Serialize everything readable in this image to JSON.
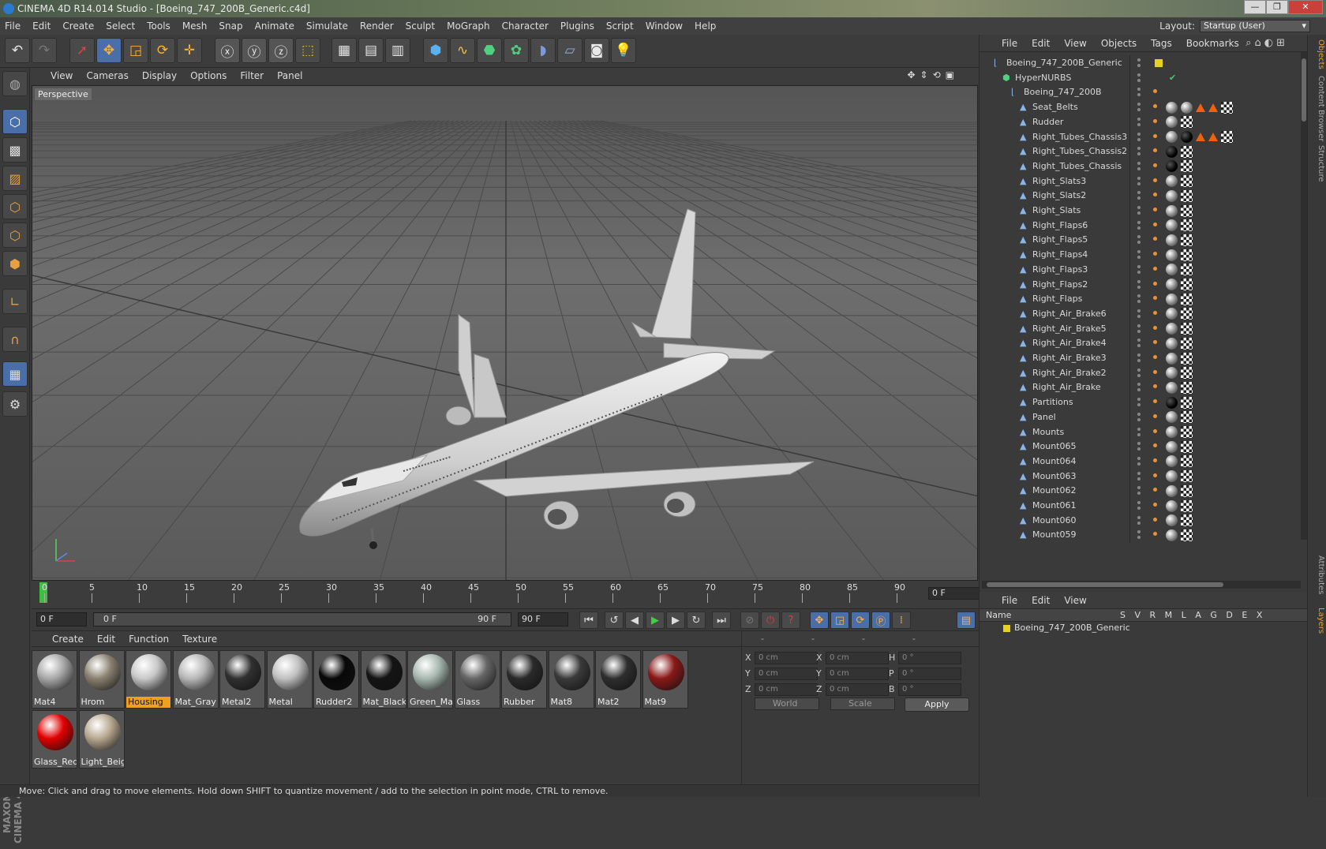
{
  "window": {
    "title": "CINEMA 4D R14.014 Studio - [Boeing_747_200B_Generic.c4d]",
    "controls": [
      "—",
      "❐",
      "✕"
    ]
  },
  "menu": [
    "File",
    "Edit",
    "Create",
    "Select",
    "Tools",
    "Mesh",
    "Snap",
    "Animate",
    "Simulate",
    "Render",
    "Sculpt",
    "MoGraph",
    "Character",
    "Plugins",
    "Script",
    "Window",
    "Help"
  ],
  "layout": {
    "label": "Layout:",
    "value": "Startup (User)"
  },
  "viewport": {
    "menu": [
      "View",
      "Cameras",
      "Display",
      "Options",
      "Filter",
      "Panel"
    ],
    "label": "Perspective"
  },
  "timeline": {
    "ticks": [
      "0",
      "5",
      "10",
      "15",
      "20",
      "25",
      "30",
      "35",
      "40",
      "45",
      "50",
      "55",
      "60",
      "65",
      "70",
      "75",
      "80",
      "85",
      "90"
    ],
    "current_frame": "0 F",
    "start_field": "0 F",
    "range_start": "0 F",
    "range_end": "90 F",
    "end_field": "90 F"
  },
  "materials": {
    "menu": [
      "Create",
      "Edit",
      "Function",
      "Texture"
    ],
    "items": [
      {
        "name": "Mat4",
        "color": "#a8a8a8",
        "selected": false
      },
      {
        "name": "Hrom",
        "color": "#8a8070",
        "selected": false
      },
      {
        "name": "Housing",
        "color": "#c8c8c8",
        "selected": true
      },
      {
        "name": "Mat_Gray",
        "color": "#b8b8b8",
        "selected": false
      },
      {
        "name": "Metal2",
        "color": "#303030",
        "selected": false
      },
      {
        "name": "Metal",
        "color": "#c0c0c0",
        "selected": false
      },
      {
        "name": "Rudder2",
        "color": "#080808",
        "selected": false
      },
      {
        "name": "Mat_Black",
        "color": "#141414",
        "selected": false
      },
      {
        "name": "Green_Mat",
        "color": "#a8b8b0",
        "selected": false
      },
      {
        "name": "Glass",
        "color": "#666666",
        "selected": false
      },
      {
        "name": "Rubber",
        "color": "#2a2a2a",
        "selected": false
      },
      {
        "name": "Mat8",
        "color": "#3a3a3a",
        "selected": false
      },
      {
        "name": "Mat2",
        "color": "#2e2e2e",
        "selected": false
      },
      {
        "name": "Mat9",
        "color": "#8a1818",
        "selected": false
      },
      {
        "name": "Glass_Red",
        "color": "#e00000",
        "selected": false
      },
      {
        "name": "Light_Beig",
        "color": "#b8a890",
        "selected": false
      }
    ]
  },
  "coords": {
    "header": [
      "--",
      "--",
      "--"
    ],
    "rows": [
      {
        "a": "X",
        "av": "0 cm",
        "b": "X",
        "bv": "0 cm",
        "c": "H",
        "cv": "0 °"
      },
      {
        "a": "Y",
        "av": "0 cm",
        "b": "Y",
        "bv": "0 cm",
        "c": "P",
        "cv": "0 °"
      },
      {
        "a": "Z",
        "av": "0 cm",
        "b": "Z",
        "bv": "0 cm",
        "c": "B",
        "cv": "0 °"
      }
    ],
    "world": "World",
    "scale": "Scale",
    "apply": "Apply"
  },
  "status": "Move: Click and drag to move elements. Hold down SHIFT to quantize movement / add to the selection in point mode, CTRL to remove.",
  "objects": {
    "menu": [
      "File",
      "Edit",
      "View",
      "Objects",
      "Tags",
      "Bookmarks"
    ],
    "tree": [
      {
        "name": "Boeing_747_200B_Generic",
        "depth": 0,
        "icon": "null",
        "tags": []
      },
      {
        "name": "HyperNURBS",
        "depth": 1,
        "icon": "nurbs",
        "tags": []
      },
      {
        "name": "Boeing_747_200B",
        "depth": 2,
        "icon": "null",
        "tags": []
      },
      {
        "name": "Seat_Belts",
        "depth": 3,
        "icon": "poly",
        "tags": [
          "s",
          "s",
          "t",
          "t",
          "c"
        ]
      },
      {
        "name": "Rudder",
        "depth": 3,
        "icon": "poly",
        "tags": [
          "s",
          "c"
        ]
      },
      {
        "name": "Right_Tubes_Chassis3",
        "depth": 3,
        "icon": "poly",
        "tags": [
          "s",
          "b",
          "t",
          "t",
          "c"
        ]
      },
      {
        "name": "Right_Tubes_Chassis2",
        "depth": 3,
        "icon": "poly",
        "tags": [
          "b",
          "c"
        ]
      },
      {
        "name": "Right_Tubes_Chassis",
        "depth": 3,
        "icon": "poly",
        "tags": [
          "b",
          "c"
        ]
      },
      {
        "name": "Right_Slats3",
        "depth": 3,
        "icon": "poly",
        "tags": [
          "s",
          "c"
        ]
      },
      {
        "name": "Right_Slats2",
        "depth": 3,
        "icon": "poly",
        "tags": [
          "s",
          "c"
        ]
      },
      {
        "name": "Right_Slats",
        "depth": 3,
        "icon": "poly",
        "tags": [
          "s",
          "c"
        ]
      },
      {
        "name": "Right_Flaps6",
        "depth": 3,
        "icon": "poly",
        "tags": [
          "s",
          "c"
        ]
      },
      {
        "name": "Right_Flaps5",
        "depth": 3,
        "icon": "poly",
        "tags": [
          "s",
          "c"
        ]
      },
      {
        "name": "Right_Flaps4",
        "depth": 3,
        "icon": "poly",
        "tags": [
          "s",
          "c"
        ]
      },
      {
        "name": "Right_Flaps3",
        "depth": 3,
        "icon": "poly",
        "tags": [
          "s",
          "c"
        ]
      },
      {
        "name": "Right_Flaps2",
        "depth": 3,
        "icon": "poly",
        "tags": [
          "s",
          "c"
        ]
      },
      {
        "name": "Right_Flaps",
        "depth": 3,
        "icon": "poly",
        "tags": [
          "s",
          "c"
        ]
      },
      {
        "name": "Right_Air_Brake6",
        "depth": 3,
        "icon": "poly",
        "tags": [
          "s",
          "c"
        ]
      },
      {
        "name": "Right_Air_Brake5",
        "depth": 3,
        "icon": "poly",
        "tags": [
          "s",
          "c"
        ]
      },
      {
        "name": "Right_Air_Brake4",
        "depth": 3,
        "icon": "poly",
        "tags": [
          "s",
          "c"
        ]
      },
      {
        "name": "Right_Air_Brake3",
        "depth": 3,
        "icon": "poly",
        "tags": [
          "s",
          "c"
        ]
      },
      {
        "name": "Right_Air_Brake2",
        "depth": 3,
        "icon": "poly",
        "tags": [
          "s",
          "c"
        ]
      },
      {
        "name": "Right_Air_Brake",
        "depth": 3,
        "icon": "poly",
        "tags": [
          "s",
          "c"
        ]
      },
      {
        "name": "Partitions",
        "depth": 3,
        "icon": "poly",
        "tags": [
          "b",
          "c"
        ]
      },
      {
        "name": "Panel",
        "depth": 3,
        "icon": "poly",
        "tags": [
          "s",
          "c"
        ]
      },
      {
        "name": "Mounts",
        "depth": 3,
        "icon": "poly",
        "tags": [
          "s",
          "c"
        ]
      },
      {
        "name": "Mount065",
        "depth": 3,
        "icon": "poly",
        "tags": [
          "s",
          "c"
        ]
      },
      {
        "name": "Mount064",
        "depth": 3,
        "icon": "poly",
        "tags": [
          "s",
          "c"
        ]
      },
      {
        "name": "Mount063",
        "depth": 3,
        "icon": "poly",
        "tags": [
          "s",
          "c"
        ]
      },
      {
        "name": "Mount062",
        "depth": 3,
        "icon": "poly",
        "tags": [
          "s",
          "c"
        ]
      },
      {
        "name": "Mount061",
        "depth": 3,
        "icon": "poly",
        "tags": [
          "s",
          "c"
        ]
      },
      {
        "name": "Mount060",
        "depth": 3,
        "icon": "poly",
        "tags": [
          "s",
          "c"
        ]
      },
      {
        "name": "Mount059",
        "depth": 3,
        "icon": "poly",
        "tags": [
          "s",
          "c"
        ]
      }
    ]
  },
  "layers": {
    "menu": [
      "File",
      "Edit",
      "View"
    ],
    "header_name": "Name",
    "columns": [
      "S",
      "V",
      "R",
      "M",
      "L",
      "A",
      "G",
      "D",
      "E",
      "X"
    ],
    "rows": [
      {
        "name": "Boeing_747_200B_Generic",
        "color": "#e8d020"
      }
    ]
  },
  "side_tabs": [
    "Objects",
    "Content Browser",
    "Structure",
    "Attributes",
    "Layers"
  ]
}
